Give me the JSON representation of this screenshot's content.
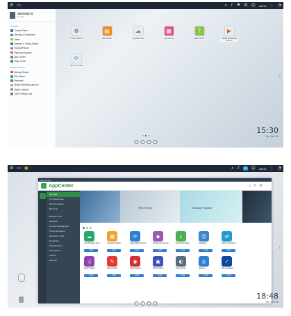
{
  "screen1": {
    "topbar": {
      "user": "admin"
    },
    "menu": {
      "host_name": "ADFS4051TS",
      "host_model": "TS-451",
      "section_system": "SYSTEM",
      "system_items": [
        "Control Panel",
        "Storage & Snapshots",
        "Users",
        "Network & Virtual Switch",
        "myQNAPcloud",
        "Resource Monitor",
        "App Center",
        "Help Center"
      ],
      "section_apps": "APPLICATIONS",
      "app_items": [
        "Backup Station",
        "File Station",
        "Helpdesk",
        "Media Streaming add-on",
        "Qsync Central",
        "SSD Profiling Tool"
      ]
    },
    "desktop_icons": [
      "Control Panel",
      "File Station",
      "myQNAPcloud",
      "App Center",
      "Help Center",
      "Media Streaming add-on",
      "Qsync Central"
    ],
    "clock": {
      "time": "15:30",
      "date": "Tue, Nov 06"
    }
  },
  "screen2": {
    "topbar": {
      "user": "admin"
    },
    "window": {
      "titlebar": "App Center",
      "app_title": "AppCenter",
      "nav": [
        "My Apps",
        "QTS Essentials",
        "Recommended",
        "Beta Lab"
      ],
      "categories": [
        "Backup/ Sync",
        "Business",
        "Content Management",
        "Communications",
        "Developer Tools",
        "Download",
        "Entertainment",
        "Surveillance",
        "Utilities",
        "Security"
      ],
      "banners": [
        "Plex Server",
        "Browser Station"
      ],
      "apps": [
        {
          "name": "Cloud Backup Sync",
          "version": "1.2.009",
          "btn": "Install"
        },
        {
          "name": "Container Station",
          "version": "2.0",
          "btn": "Install"
        },
        {
          "name": "Hybrid Backup Sync",
          "version": "2.1.1",
          "btn": "Install"
        },
        {
          "name": "Multimedia Console",
          "version": "1.0",
          "btn": "Install"
        },
        {
          "name": "Download Station",
          "version": "5.1.0",
          "btn": "Install"
        },
        {
          "name": "HelpDesk",
          "version": "2.1.0",
          "btn": "Install"
        },
        {
          "name": "Hybrid CloudSync",
          "version": "2.0",
          "btn": "Install"
        },
        {
          "name": "",
          "version": "",
          "btn": ""
        },
        {
          "name": "Music Station",
          "version": "5.1.0",
          "btn": "Install"
        },
        {
          "name": "Notes Station",
          "version": "2.1.1",
          "btn": "Install"
        },
        {
          "name": "Photo Station",
          "version": "5.6.0",
          "btn": "Install"
        },
        {
          "name": "Photo Station",
          "version": "",
          "btn": "Install"
        },
        {
          "name": "Proxy Server",
          "version": "1.0",
          "btn": "Install"
        },
        {
          "name": "Qcenter",
          "version": "1.0",
          "btn": "Install"
        },
        {
          "name": "SSL Certificate",
          "version": "",
          "btn": "Install"
        },
        {
          "name": "",
          "version": "",
          "btn": ""
        }
      ]
    },
    "clock": {
      "time": "18:48",
      "date": "Tue, Nov 06"
    }
  },
  "colors": {
    "accent_green": "#2f8f47",
    "topbar": "#1d2834",
    "install_blue": "#2f7fd1"
  }
}
